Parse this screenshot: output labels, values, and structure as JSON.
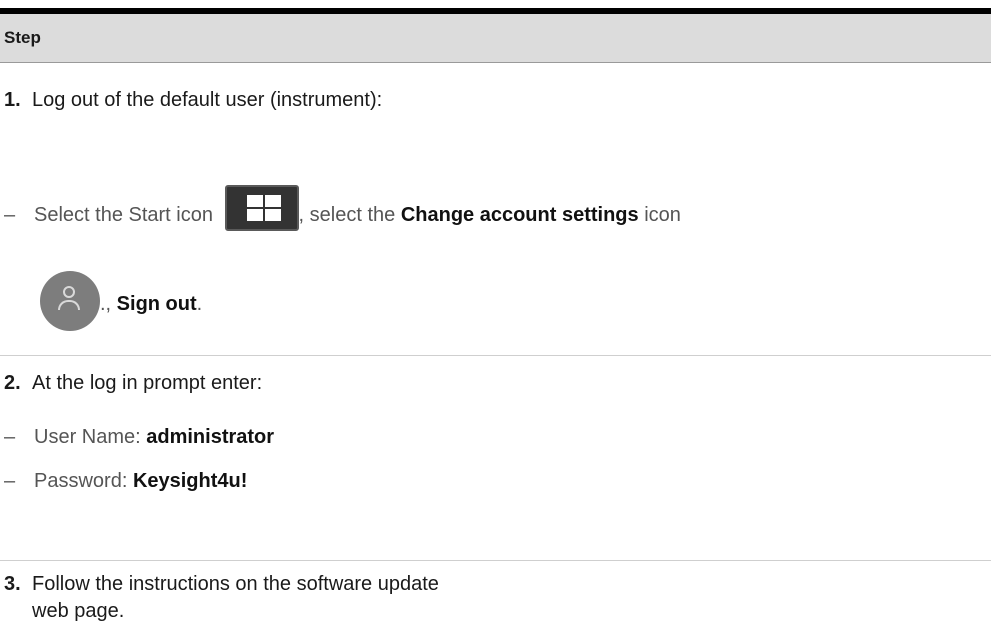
{
  "table": {
    "header": "Step",
    "steps": [
      {
        "number": "1.",
        "text": "Log out of the default user (instrument):",
        "substeps": [
          {
            "part1": "Select the Start icon",
            "part2": ", select the ",
            "bold1": "Change account settings",
            "part3": " icon",
            "line2_pre": "., ",
            "bold2": "Sign out",
            "line2_post": "."
          }
        ]
      },
      {
        "number": "2.",
        "text": "At the log in prompt enter:",
        "substeps": [
          {
            "label": "User Name: ",
            "value": "administrator"
          },
          {
            "label": "Password: ",
            "value": "Keysight4u!"
          }
        ]
      },
      {
        "number": "3.",
        "text_line1": "Follow the instructions on the software update",
        "text_line2": "web page."
      }
    ]
  },
  "dash": "–",
  "icons": {
    "start": "windows-start-icon",
    "account": "account-user-icon"
  },
  "colors": {
    "header_bg": "#dcdcdc",
    "top_rule": "#000000",
    "start_icon_bg": "#333333",
    "account_icon_bg": "#7d7d7d"
  }
}
